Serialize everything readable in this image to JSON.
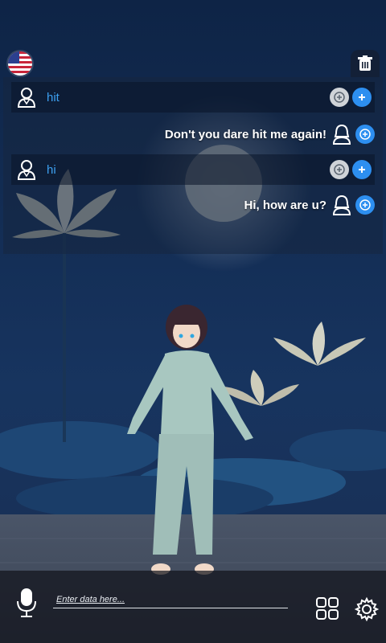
{
  "header": {
    "language_icon": "us-flag-icon",
    "delete_icon": "trash-icon"
  },
  "chat": {
    "messages": [
      {
        "role": "user",
        "text": "hit"
      },
      {
        "role": "assistant",
        "text": "Don't you dare hit me again!"
      },
      {
        "role": "user",
        "text": "hi"
      },
      {
        "role": "assistant",
        "text": "Hi, how are u?"
      }
    ]
  },
  "input": {
    "placeholder": "Enter data here..."
  },
  "toolbar": {
    "mic_icon": "microphone-icon",
    "grid_icon": "grid-icon",
    "settings_icon": "gear-icon"
  },
  "colors": {
    "accent": "#2d8ff0",
    "user_text": "#3da0f0",
    "panel": "#16263f"
  }
}
